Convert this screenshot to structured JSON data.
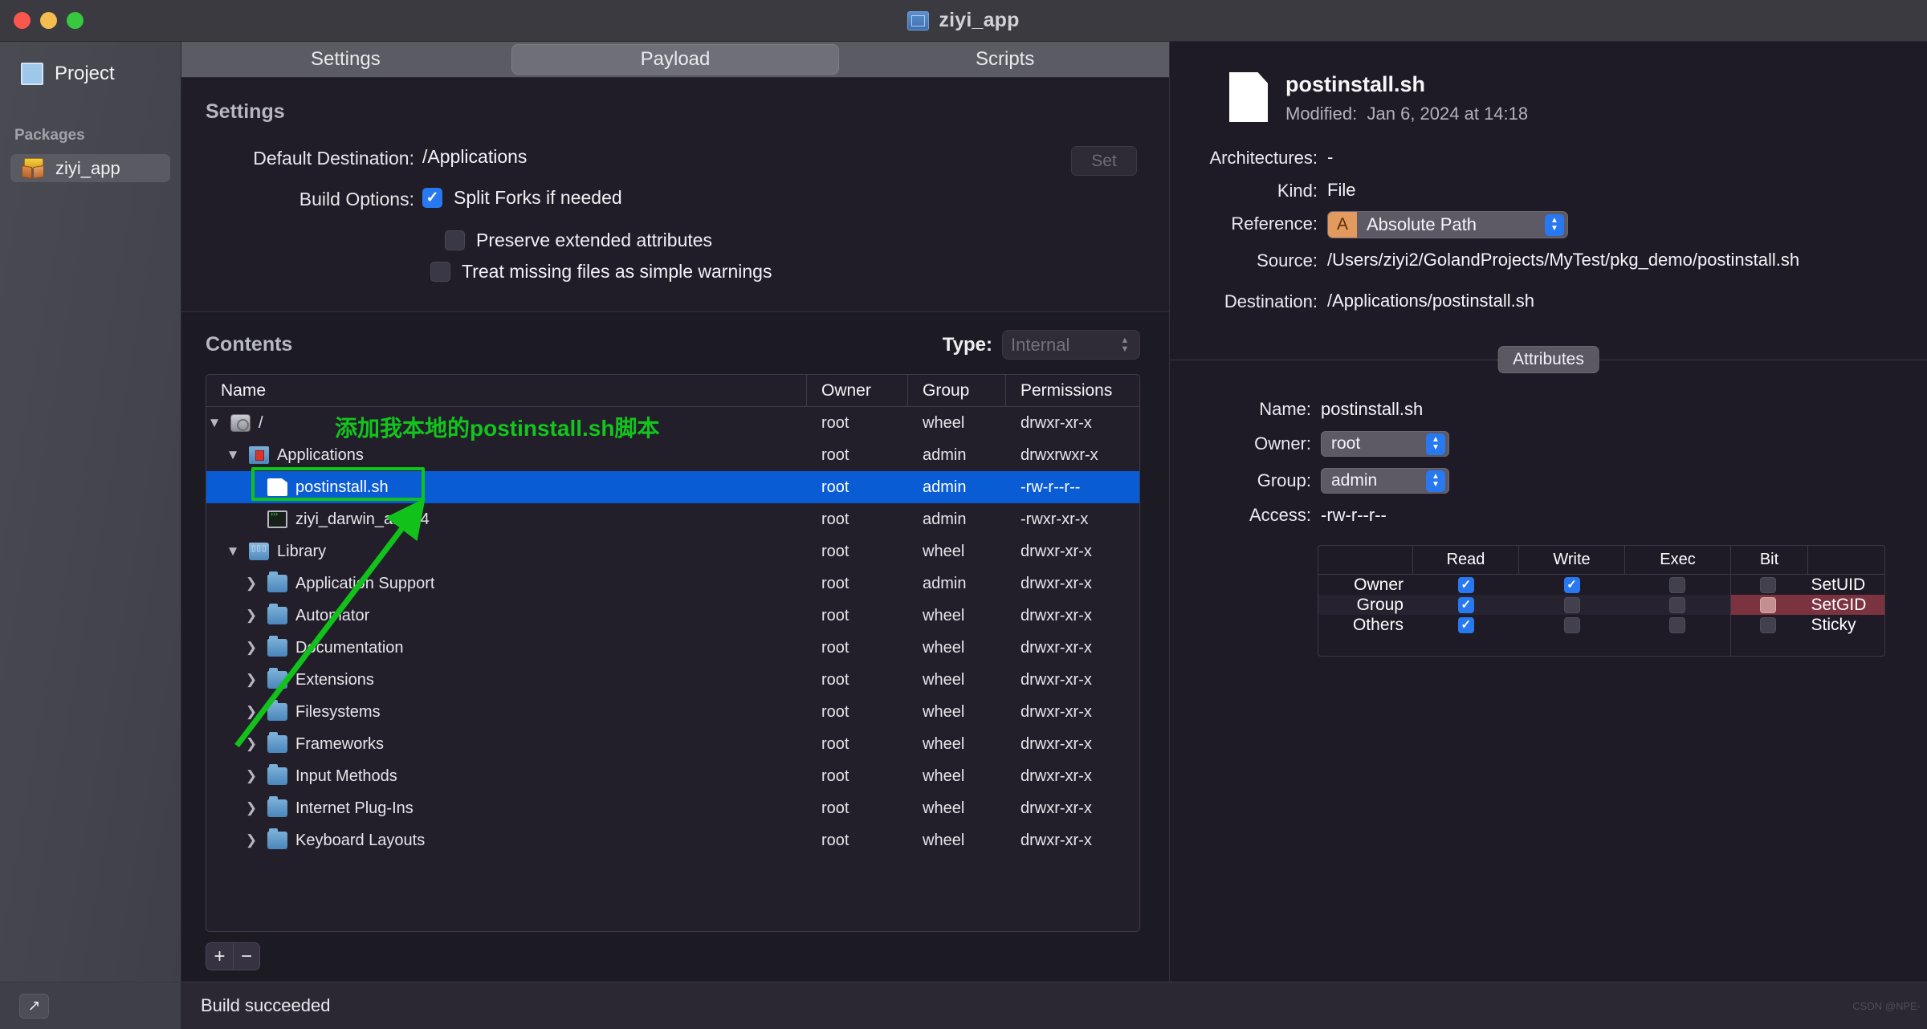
{
  "window": {
    "title": "ziyi_app",
    "title_icon": "package-window-icon",
    "traffic_lights": [
      "close-button",
      "minimize-button",
      "maximize-button"
    ]
  },
  "sidebar": {
    "project_label": "Project",
    "section_label": "Packages",
    "items": [
      {
        "label": "ziyi_app",
        "icon": "package-icon",
        "selected": true
      }
    ]
  },
  "tabs": [
    {
      "label": "Settings",
      "active": false
    },
    {
      "label": "Payload",
      "active": true
    },
    {
      "label": "Scripts",
      "active": false
    }
  ],
  "settings": {
    "heading": "Settings",
    "default_destination_label": "Default Destination:",
    "default_destination_value": "/Applications",
    "set_button": "Set",
    "build_options_label": "Build Options:",
    "options": [
      {
        "label": "Split Forks if needed",
        "checked": true
      },
      {
        "label": "Preserve extended attributes",
        "checked": false
      },
      {
        "label": "Treat missing files as simple warnings",
        "checked": false
      }
    ]
  },
  "contents": {
    "heading": "Contents",
    "type_label": "Type:",
    "type_value": "Internal",
    "columns": [
      "Name",
      "Owner",
      "Group",
      "Permissions"
    ],
    "rows": [
      {
        "indent": 0,
        "chev": "▼",
        "icon": "hard-disk-icon",
        "name": "/",
        "owner": "root",
        "group": "wheel",
        "perm": "drwxr-xr-x",
        "selected": false
      },
      {
        "indent": 1,
        "chev": "▼",
        "icon": "applications-folder-icon",
        "name": "Applications",
        "owner": "root",
        "group": "admin",
        "perm": "drwxrwxr-x",
        "selected": false
      },
      {
        "indent": 2,
        "chev": "",
        "icon": "document-icon",
        "name": "postinstall.sh",
        "owner": "root",
        "group": "admin",
        "perm": "-rw-r--r--",
        "selected": true
      },
      {
        "indent": 2,
        "chev": "",
        "icon": "binary-icon",
        "name": "ziyi_darwin_arm64",
        "owner": "root",
        "group": "admin",
        "perm": "-rwxr-xr-x",
        "selected": false
      },
      {
        "indent": 1,
        "chev": "▼",
        "icon": "library-folder-icon",
        "name": "Library",
        "owner": "root",
        "group": "wheel",
        "perm": "drwxr-xr-x",
        "selected": false
      },
      {
        "indent": 2,
        "chev": "❯",
        "icon": "folder-icon",
        "name": "Application Support",
        "owner": "root",
        "group": "admin",
        "perm": "drwxr-xr-x",
        "selected": false
      },
      {
        "indent": 2,
        "chev": "❯",
        "icon": "folder-icon",
        "name": "Automator",
        "owner": "root",
        "group": "wheel",
        "perm": "drwxr-xr-x",
        "selected": false
      },
      {
        "indent": 2,
        "chev": "❯",
        "icon": "folder-icon",
        "name": "Documentation",
        "owner": "root",
        "group": "wheel",
        "perm": "drwxr-xr-x",
        "selected": false
      },
      {
        "indent": 2,
        "chev": "❯",
        "icon": "folder-icon",
        "name": "Extensions",
        "owner": "root",
        "group": "wheel",
        "perm": "drwxr-xr-x",
        "selected": false
      },
      {
        "indent": 2,
        "chev": "❯",
        "icon": "folder-icon",
        "name": "Filesystems",
        "owner": "root",
        "group": "wheel",
        "perm": "drwxr-xr-x",
        "selected": false
      },
      {
        "indent": 2,
        "chev": "❯",
        "icon": "folder-icon",
        "name": "Frameworks",
        "owner": "root",
        "group": "wheel",
        "perm": "drwxr-xr-x",
        "selected": false
      },
      {
        "indent": 2,
        "chev": "❯",
        "icon": "folder-icon",
        "name": "Input Methods",
        "owner": "root",
        "group": "wheel",
        "perm": "drwxr-xr-x",
        "selected": false
      },
      {
        "indent": 2,
        "chev": "❯",
        "icon": "folder-icon",
        "name": "Internet Plug-Ins",
        "owner": "root",
        "group": "wheel",
        "perm": "drwxr-xr-x",
        "selected": false
      },
      {
        "indent": 2,
        "chev": "❯",
        "icon": "folder-icon",
        "name": "Keyboard Layouts",
        "owner": "root",
        "group": "wheel",
        "perm": "drwxr-xr-x",
        "selected": false
      }
    ],
    "add_button": "+",
    "remove_button": "−"
  },
  "annotation": {
    "text": "添加我本地的postinstall.sh脚本",
    "color": "#13c41c"
  },
  "inspector": {
    "file_name": "postinstall.sh",
    "modified_label": "Modified:",
    "modified_value": "Jan 6, 2024 at 14:18",
    "fields": [
      {
        "label": "Architectures:",
        "value": "-"
      },
      {
        "label": "Kind:",
        "value": "File"
      }
    ],
    "reference_label": "Reference:",
    "reference_badge": "A",
    "reference_value": "Absolute Path",
    "source_label": "Source:",
    "source_value": "/Users/ziyi2/GolandProjects/MyTest/pkg_demo/postinstall.sh",
    "destination_label": "Destination:",
    "destination_value": "/Applications/postinstall.sh",
    "attributes_tab": "Attributes",
    "attributes": {
      "name_label": "Name:",
      "name_value": "postinstall.sh",
      "owner_label": "Owner:",
      "owner_value": "root",
      "group_label": "Group:",
      "group_value": "admin",
      "access_label": "Access:",
      "access_value": "-rw-r--r--"
    },
    "permissions": {
      "headers": [
        "",
        "Read",
        "Write",
        "Exec"
      ],
      "bit_header": "Bit",
      "rows": [
        {
          "label": "Owner",
          "read": true,
          "write": true,
          "exec": false,
          "bit_name": "SetUID",
          "bit": false,
          "bit_highlight": false
        },
        {
          "label": "Group",
          "read": true,
          "write": false,
          "exec": false,
          "bit_name": "SetGID",
          "bit": false,
          "bit_highlight": true
        },
        {
          "label": "Others",
          "read": true,
          "write": false,
          "exec": false,
          "bit_name": "Sticky",
          "bit": false,
          "bit_highlight": false
        }
      ]
    }
  },
  "statusbar": {
    "export_icon": "export-arrow-icon",
    "status_text": "Build succeeded",
    "watermark": "CSDN @NPE-"
  }
}
